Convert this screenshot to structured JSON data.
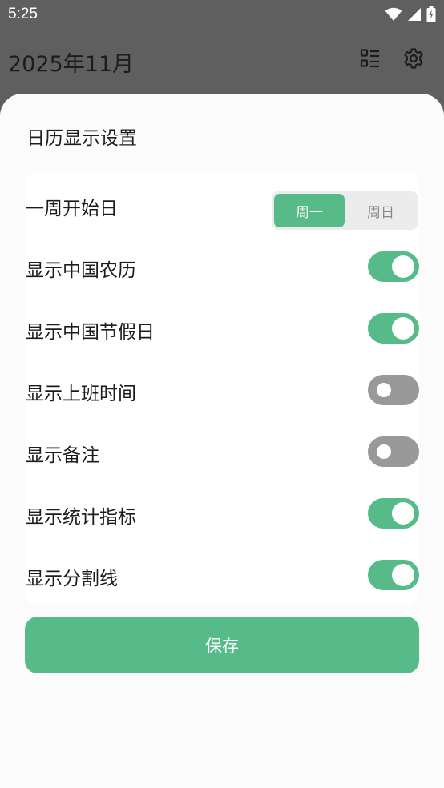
{
  "status_bar": {
    "time": "5:25",
    "icons": [
      "wifi-icon",
      "signal-icon",
      "battery-charging-icon"
    ]
  },
  "header": {
    "title": "2025年11月",
    "icons": [
      "list-view-icon",
      "gear-icon"
    ]
  },
  "sheet": {
    "title": "日历显示设置",
    "rows": [
      {
        "label": "一周开始日",
        "control": "segmented",
        "options": [
          "周一",
          "周日"
        ],
        "selected": "周一"
      },
      {
        "label": "显示中国农历",
        "control": "toggle",
        "on": true
      },
      {
        "label": "显示中国节假日",
        "control": "toggle",
        "on": true
      },
      {
        "label": "显示上班时间",
        "control": "toggle",
        "on": false
      },
      {
        "label": "显示备注",
        "control": "toggle",
        "on": false
      },
      {
        "label": "显示统计指标",
        "control": "toggle",
        "on": true
      },
      {
        "label": "显示分割线",
        "control": "toggle",
        "on": true
      }
    ],
    "save_label": "保存"
  },
  "colors": {
    "accent": "#57bb89",
    "toggle_off": "#999999",
    "scrim": "#5f5f5f",
    "sheet_bg": "#fbfbfc"
  }
}
